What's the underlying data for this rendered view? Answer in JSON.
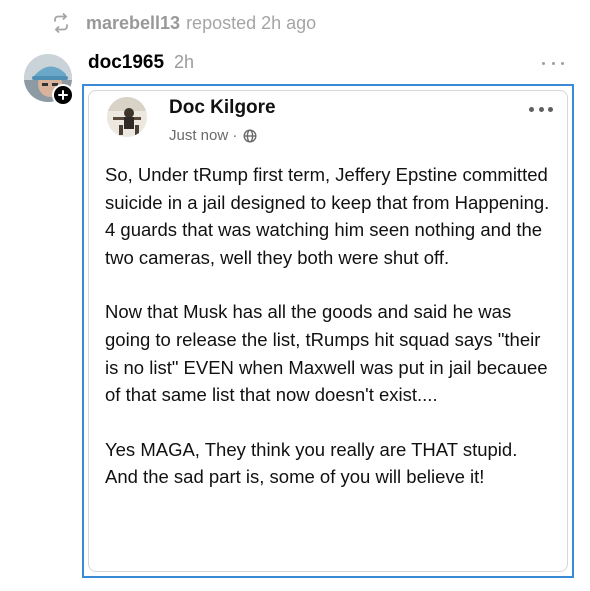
{
  "repost": {
    "user": "marebell13",
    "suffix": "reposted 2h ago",
    "icon": "repost-icon"
  },
  "post": {
    "author": "doc1965",
    "time": "2h",
    "more_icon": "more-horizontal-icon",
    "follow_icon": "plus-icon"
  },
  "embedded": {
    "name": "Doc Kilgore",
    "meta": "Just now ·",
    "privacy_icon": "globe-icon",
    "more_icon": "more-horizontal-icon",
    "paragraphs": [
      "So, Under tRump first term, Jeffery  Epstine committed suicide in a jail designed to keep that from Happening.  4 guards that was watching him seen nothing and the two cameras, well they both were shut off.",
      "Now that Musk has all the goods and said he was going to release the list, tRumps hit squad says \"their is no list\"  EVEN when Maxwell was put in jail becauee of that same list that now doesn't exist....",
      "Yes MAGA, They think you really are THAT stupid. And the sad part is, some of you will believe it!"
    ]
  },
  "colors": {
    "highlight_border": "#3b8ad6",
    "muted_text": "#9b9b9b"
  }
}
